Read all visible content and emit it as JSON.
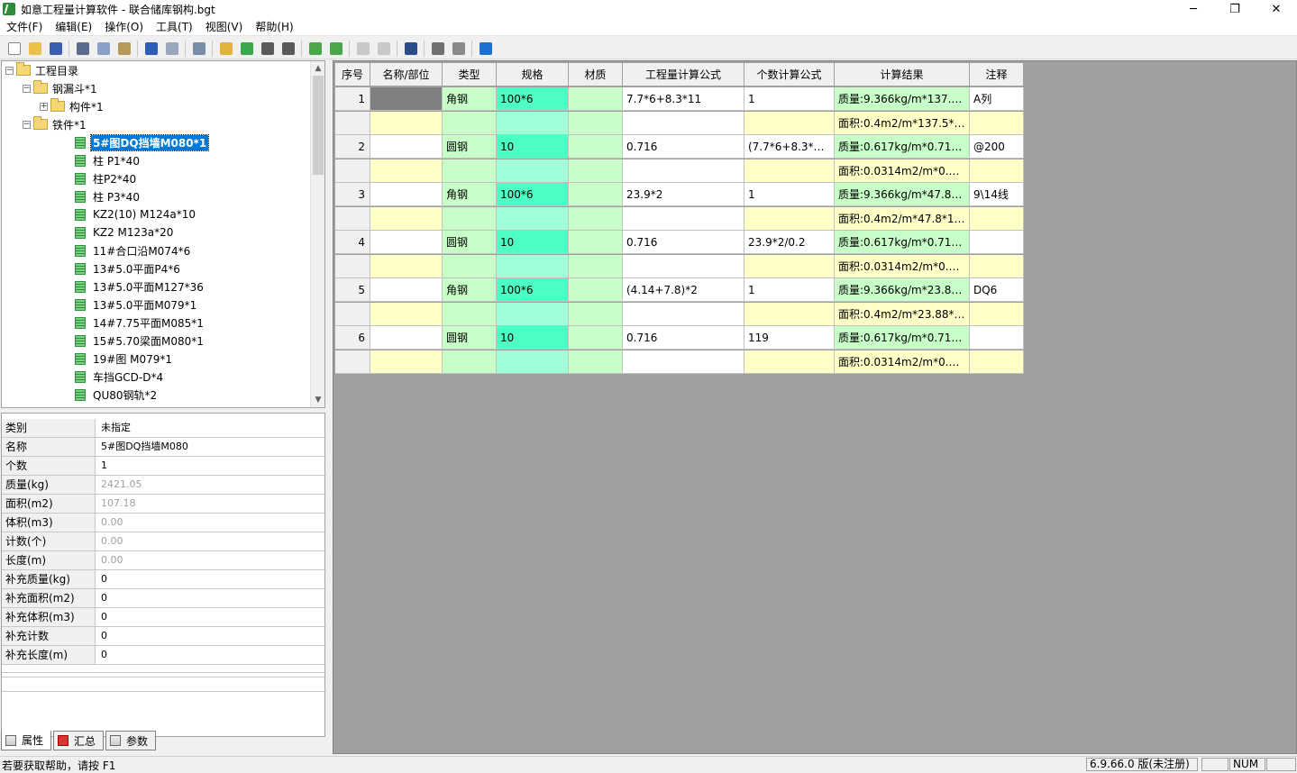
{
  "window": {
    "title": "如意工程量计算软件 - 联合储库钢构.bgt",
    "minimize": "─",
    "restore": "❐",
    "close": "✕"
  },
  "menu": [
    "文件(F)",
    "编辑(E)",
    "操作(O)",
    "工具(T)",
    "视图(V)",
    "帮助(H)"
  ],
  "toolbar": [
    {
      "icon": "new-file-icon",
      "color": "#ffffff"
    },
    {
      "icon": "open-folder-icon",
      "color": "#e8c04a"
    },
    {
      "icon": "save-icon",
      "color": "#3a5fb0"
    },
    {
      "sep": true
    },
    {
      "icon": "cut-icon",
      "color": "#5a6b8c"
    },
    {
      "icon": "copy-icon",
      "color": "#8aa0c8"
    },
    {
      "icon": "paste-icon",
      "color": "#b59a5a"
    },
    {
      "sep": true
    },
    {
      "icon": "undo-icon",
      "color": "#2b5cb8"
    },
    {
      "icon": "redo-icon",
      "color": "#9aa7bd"
    },
    {
      "sep": true
    },
    {
      "icon": "eraser-icon",
      "color": "#7a8da8"
    },
    {
      "sep": true
    },
    {
      "icon": "add-folder-icon",
      "color": "#e0b43c"
    },
    {
      "icon": "add-component-icon",
      "color": "#3aa84a"
    },
    {
      "icon": "indent-icon",
      "color": "#5a5a5a"
    },
    {
      "icon": "outdent-icon",
      "color": "#5a5a5a"
    },
    {
      "sep": true
    },
    {
      "icon": "move-up-icon",
      "color": "#4aa84a"
    },
    {
      "icon": "move-down-icon",
      "color": "#4aa84a"
    },
    {
      "sep": true
    },
    {
      "icon": "lock-icon",
      "color": "#c8c8c8"
    },
    {
      "icon": "unlock-icon",
      "color": "#c8c8c8"
    },
    {
      "sep": true
    },
    {
      "icon": "frame-icon",
      "color": "#2a4a8a"
    },
    {
      "sep": true
    },
    {
      "icon": "print-icon",
      "color": "#707070"
    },
    {
      "icon": "print-preview-icon",
      "color": "#8a8a8a"
    },
    {
      "sep": true
    },
    {
      "icon": "help-icon",
      "color": "#1e6fd0"
    }
  ],
  "tree": [
    {
      "level": 0,
      "label": "工程目录",
      "type": "folder",
      "exp": "−"
    },
    {
      "level": 1,
      "label": "钢漏斗*1",
      "type": "folder",
      "exp": "−"
    },
    {
      "level": 2,
      "label": "构件*1",
      "type": "folder",
      "exp": "+"
    },
    {
      "level": 1,
      "label": "铁件*1",
      "type": "folder",
      "exp": "−"
    },
    {
      "level": 2,
      "label": "5#图DQ挡墙M080*1",
      "type": "item",
      "selected": true
    },
    {
      "level": 2,
      "label": "柱 P1*40",
      "type": "item"
    },
    {
      "level": 2,
      "label": "柱P2*40",
      "type": "item"
    },
    {
      "level": 2,
      "label": "柱 P3*40",
      "type": "item"
    },
    {
      "level": 2,
      "label": "KZ2(10) M124a*10",
      "type": "item"
    },
    {
      "level": 2,
      "label": "KZ2  M123a*20",
      "type": "item"
    },
    {
      "level": 2,
      "label": "11#合口沿M074*6",
      "type": "item"
    },
    {
      "level": 2,
      "label": "13#5.0平面P4*6",
      "type": "item"
    },
    {
      "level": 2,
      "label": "13#5.0平面M127*36",
      "type": "item"
    },
    {
      "level": 2,
      "label": "13#5.0平面M079*1",
      "type": "item"
    },
    {
      "level": 2,
      "label": "14#7.75平面M085*1",
      "type": "item"
    },
    {
      "level": 2,
      "label": "15#5.70梁面M080*1",
      "type": "item"
    },
    {
      "level": 2,
      "label": "19#图 M079*1",
      "type": "item"
    },
    {
      "level": 2,
      "label": "车挡GCD-D*4",
      "type": "item"
    },
    {
      "level": 2,
      "label": "QU80钢轨*2",
      "type": "item"
    }
  ],
  "props": [
    {
      "k": "类别",
      "v": "未指定",
      "gray": false
    },
    {
      "k": "名称",
      "v": "5#图DQ挡墙M080",
      "gray": false
    },
    {
      "k": "个数",
      "v": "1",
      "gray": false
    },
    {
      "k": "质量(kg)",
      "v": "2421.05",
      "gray": true
    },
    {
      "k": "面积(m2)",
      "v": "107.18",
      "gray": true
    },
    {
      "k": "体积(m3)",
      "v": "0.00",
      "gray": true
    },
    {
      "k": "计数(个)",
      "v": "0.00",
      "gray": true
    },
    {
      "k": "长度(m)",
      "v": "0.00",
      "gray": true
    },
    {
      "k": "补充质量(kg)",
      "v": "0",
      "gray": false
    },
    {
      "k": "补充面积(m2)",
      "v": "0",
      "gray": false
    },
    {
      "k": "补充体积(m3)",
      "v": "0",
      "gray": false
    },
    {
      "k": "补充计数",
      "v": "0",
      "gray": false
    },
    {
      "k": "补充长度(m)",
      "v": "0",
      "gray": false
    }
  ],
  "tabs": [
    {
      "label": "属性",
      "icon": "doc"
    },
    {
      "label": "汇总",
      "icon": "red"
    },
    {
      "label": "参数",
      "icon": "doc"
    }
  ],
  "grid": {
    "headers": [
      "序号",
      "名称/部位",
      "类型",
      "规格",
      "材质",
      "工程量计算公式",
      "个数计算公式",
      "计算结果",
      "注释"
    ],
    "rows": [
      {
        "no": "1",
        "name": "",
        "type": "角钢",
        "spec": "100*6",
        "mat": "",
        "formula": "7.7*6+8.3*11",
        "count": "1",
        "result": "质量:9.366kg/m*137.5*...",
        "note": "A列",
        "area": "面积:0.4m2/m*137.5*1..."
      },
      {
        "no": "2",
        "name": "",
        "type": "圆钢",
        "spec": "10",
        "mat": "",
        "formula": "0.716",
        "count": "(7.7*6+8.3*11)...",
        "result": "质量:0.617kg/m*0.716*...",
        "note": "@200",
        "area": "面积:0.0314m2/m*0.71..."
      },
      {
        "no": "3",
        "name": "",
        "type": "角钢",
        "spec": "100*6",
        "mat": "",
        "formula": "23.9*2",
        "count": "1",
        "result": "质量:9.366kg/m*47.8*1...",
        "note": "9\\14线",
        "area": "面积:0.4m2/m*47.8*1=..."
      },
      {
        "no": "4",
        "name": "",
        "type": "圆钢",
        "spec": "10",
        "mat": "",
        "formula": "0.716",
        "count": "23.9*2/0.2",
        "result": "质量:0.617kg/m*0.716*...",
        "note": "",
        "area": "面积:0.0314m2/m*0.71..."
      },
      {
        "no": "5",
        "name": "",
        "type": "角钢",
        "spec": "100*6",
        "mat": "",
        "formula": "(4.14+7.8)*2",
        "count": "1",
        "result": "质量:9.366kg/m*23.88*...",
        "note": "DQ6",
        "area": "面积:0.4m2/m*23.88*1..."
      },
      {
        "no": "6",
        "name": "",
        "type": "圆钢",
        "spec": "10",
        "mat": "",
        "formula": "0.716",
        "count": "119",
        "result": "质量:0.617kg/m*0.716*...",
        "note": "",
        "area": "面积:0.0314m2/m*0.71..."
      }
    ]
  },
  "status": {
    "help": "若要获取帮助，请按 F1",
    "version": "6.9.66.0 版(未注册)",
    "num": "NUM"
  },
  "colors": {
    "yellow": "#ffffc8",
    "green": "#c8ffc8",
    "spec": "#4dffc4",
    "specLight": "#a0ffd8",
    "result": "#c8ffc8",
    "selected": "#0078d7"
  }
}
